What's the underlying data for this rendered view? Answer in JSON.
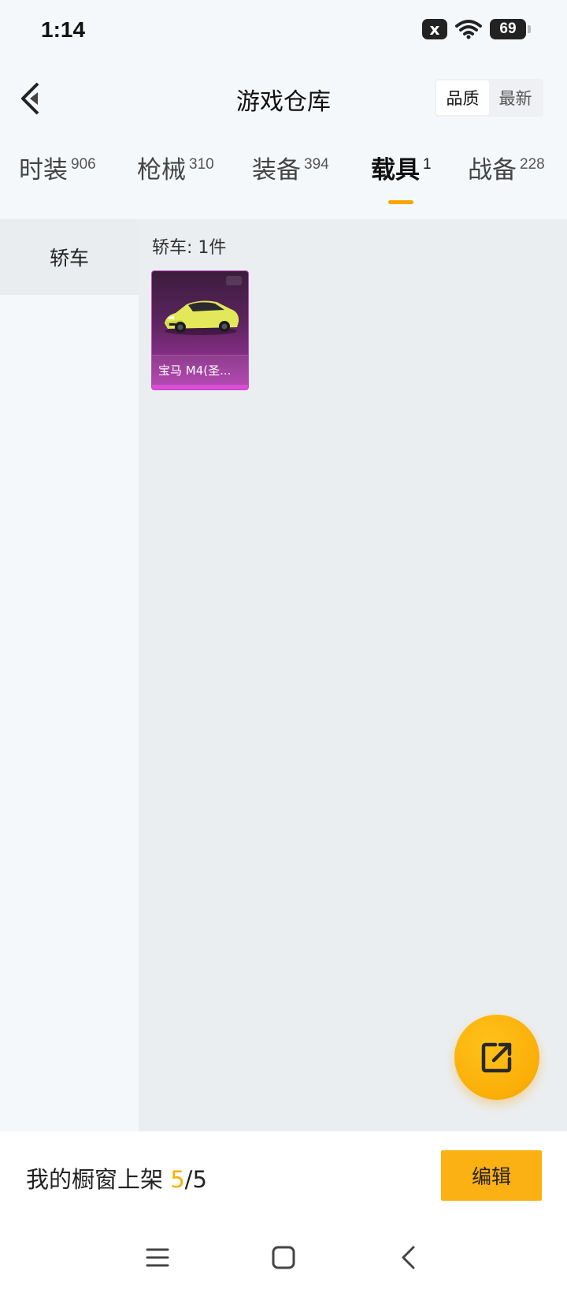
{
  "status_bar": {
    "time": "1:14",
    "sim_icon": "x",
    "battery": "69"
  },
  "header": {
    "title": "游戏仓库",
    "sort_options": [
      {
        "label": "品质",
        "active": true
      },
      {
        "label": "最新",
        "active": false
      }
    ]
  },
  "tabs": [
    {
      "label": "时装",
      "count": "906",
      "active": false
    },
    {
      "label": "枪械",
      "count": "310",
      "active": false
    },
    {
      "label": "装备",
      "count": "394",
      "active": false
    },
    {
      "label": "载具",
      "count": "1",
      "active": true
    },
    {
      "label": "战备",
      "count": "228",
      "active": false
    }
  ],
  "sidebar": {
    "items": [
      {
        "label": "轿车",
        "active": true
      }
    ]
  },
  "content": {
    "section_title": "轿车: 1件",
    "items": [
      {
        "name": "宝马 M4(圣...",
        "image": "yellow-sports-car",
        "rarity_color": "#b43cb1"
      }
    ]
  },
  "bottom_bar": {
    "showcase_label": "我的橱窗上架 ",
    "showcase_current": "5",
    "showcase_total": "/5",
    "edit_label": "编辑"
  },
  "colors": {
    "accent": "#f5a600",
    "fab": "#fbb10a"
  }
}
